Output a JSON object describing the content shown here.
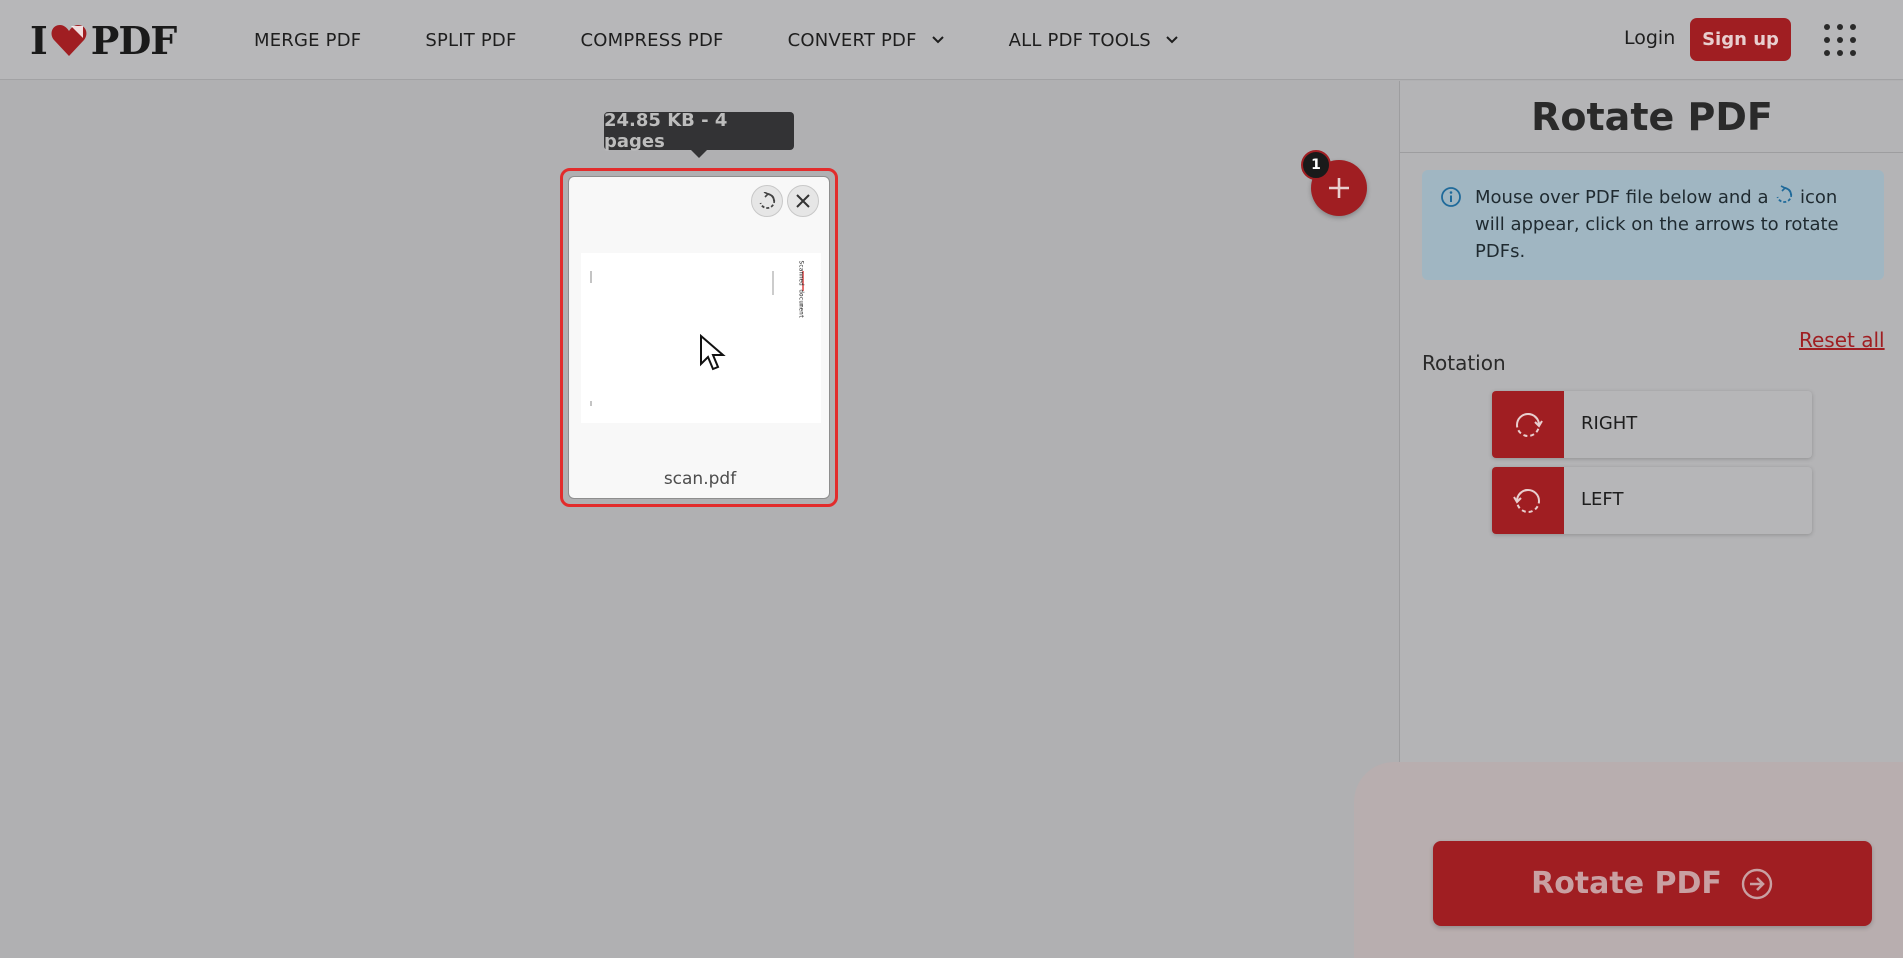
{
  "header": {
    "logo_left": "I",
    "logo_right": "PDF",
    "nav": [
      {
        "label": "MERGE PDF"
      },
      {
        "label": "SPLIT PDF"
      },
      {
        "label": "COMPRESS PDF"
      },
      {
        "label": "CONVERT PDF"
      },
      {
        "label": "ALL PDF TOOLS"
      }
    ],
    "login_label": "Login",
    "signup_label": "Sign up"
  },
  "file": {
    "tooltip": "24.85 KB - 4 pages",
    "name": "scan.pdf",
    "thumb_text": "Scanned document"
  },
  "add_files": {
    "count": "1"
  },
  "sidebar": {
    "title": "Rotate PDF",
    "info_before_icon": "Mouse over PDF file below and a",
    "info_after_icon": "icon will appear, click on the arrows to rotate PDFs.",
    "reset_label": "Reset all",
    "rotation_label": "Rotation",
    "right_label": "RIGHT",
    "left_label": "LEFT",
    "submit_label": "Rotate PDF"
  },
  "colors": {
    "brand_red": "#a01e22",
    "selection_red": "#e22c2c",
    "info_blue": "#a0b6c2"
  }
}
